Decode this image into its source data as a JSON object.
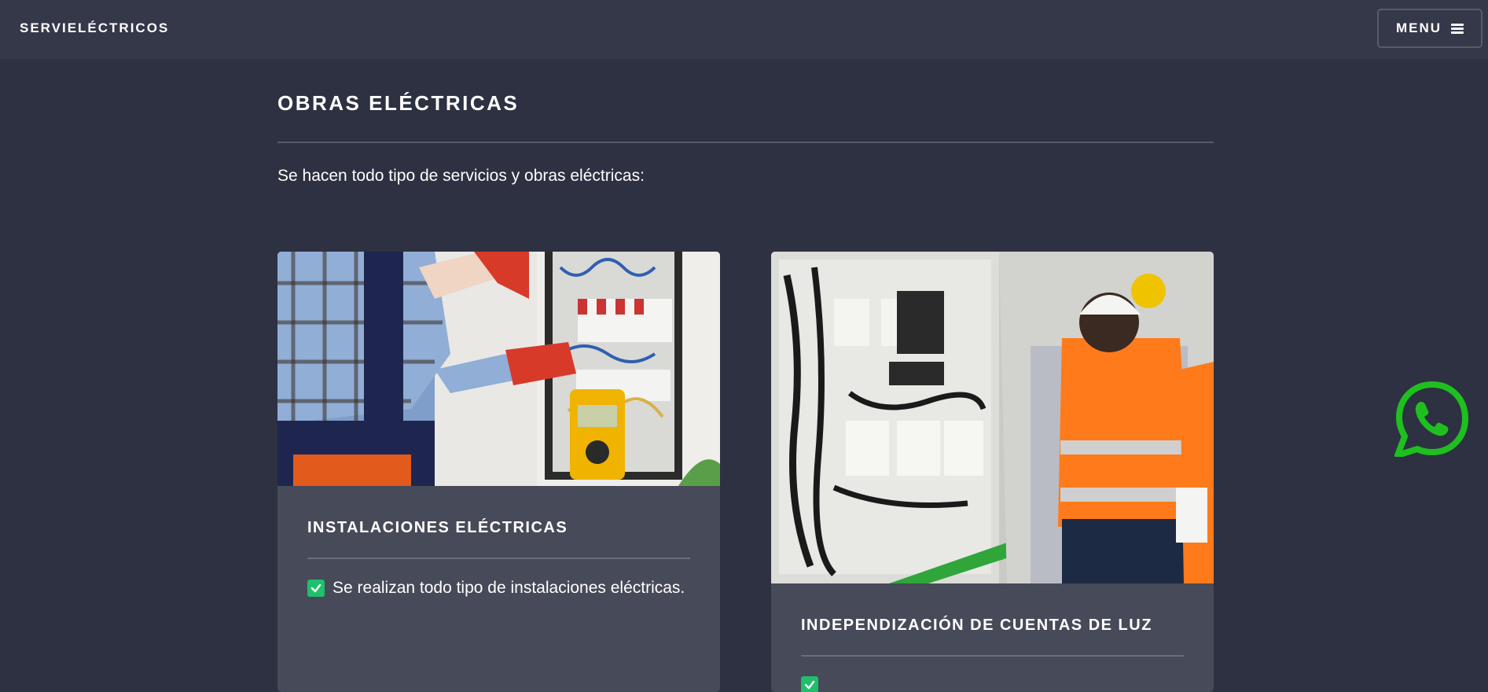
{
  "header": {
    "brand": "SERVIELÉCTRICOS",
    "menu_label": "MENU",
    "menu_icon": "hamburger-icon"
  },
  "main": {
    "title": "OBRAS ELÉCTRICAS",
    "intro": "Se hacen todo tipo de servicios y obras eléctricas:"
  },
  "cards": [
    {
      "image": "electrician-multimeter-photo",
      "heading": "INSTALACIONES ELÉCTRICAS",
      "items": [
        "Se realizan todo tipo de instalaciones eléctricas."
      ]
    },
    {
      "image": "electrical-panel-worker-photo",
      "heading": "INDEPENDIZACIÓN DE CUENTAS DE LUZ",
      "items": []
    }
  ],
  "floating": {
    "whatsapp_icon": "whatsapp-icon"
  },
  "colors": {
    "background": "#2e3141",
    "header": "#353849",
    "card": "#474a58",
    "check": "#1fbf6b",
    "whatsapp": "#1fbf1f"
  }
}
